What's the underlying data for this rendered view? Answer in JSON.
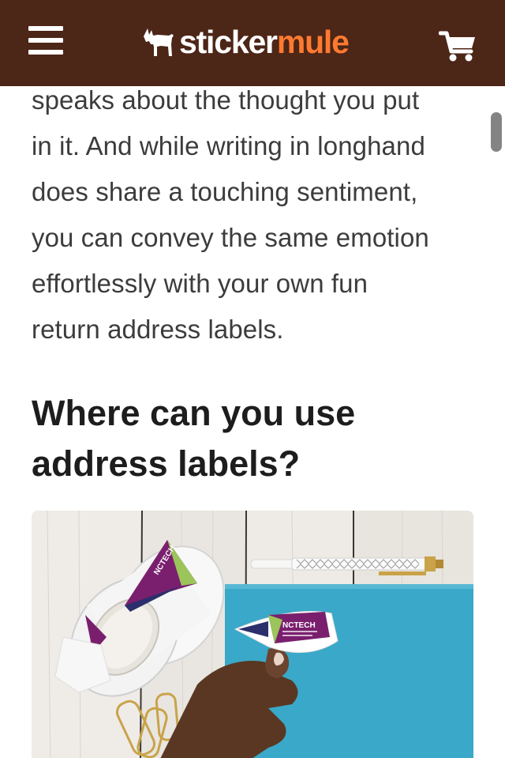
{
  "header": {
    "menu_icon": "hamburger-menu-icon",
    "logo": {
      "icon": "mule-logo-icon",
      "brand_part1": "sticker",
      "brand_part2": "mule"
    },
    "cart_icon": "shopping-cart-icon"
  },
  "article": {
    "paragraph_lines": [
      "speaks about the thought you put",
      "in it. And while writing in longhand",
      "does share a touching sentiment,",
      "you can convey the same emotion",
      "effortlessly with your own fun",
      "return address labels."
    ],
    "heading_lines": [
      "Where can you use",
      "address labels?"
    ],
    "image": {
      "label_brand_text": "NCTECH"
    }
  },
  "colors": {
    "header_bg": "#4c2617",
    "brand_orange": "#ff7a30",
    "text_body": "#3c3c3c",
    "text_heading": "#1d1d1d",
    "folder_blue": "#3aa8c8",
    "label_purple": "#7a1f6e",
    "label_green": "#9bc55a",
    "label_navy": "#2b2f6b"
  }
}
